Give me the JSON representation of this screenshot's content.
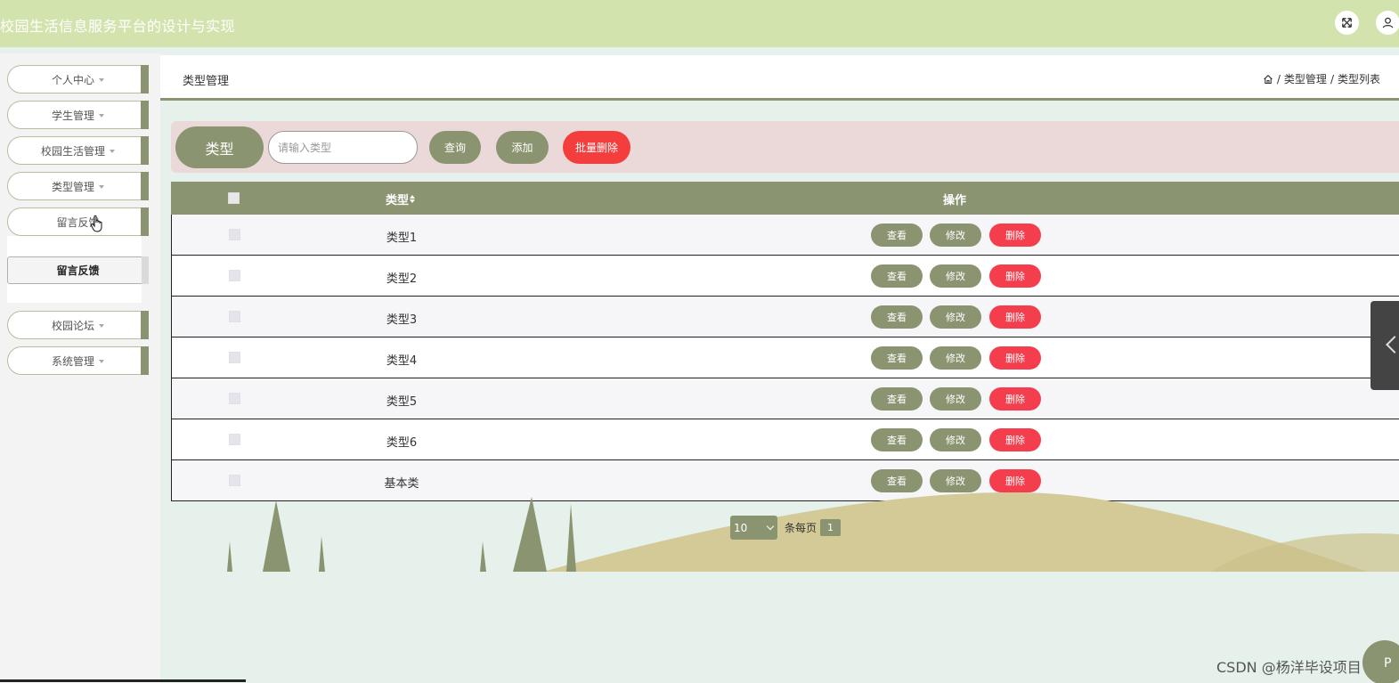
{
  "header": {
    "app_title": "校园生活信息服务平台的设计与实现"
  },
  "sidebar": {
    "items": [
      {
        "label": "个人中心"
      },
      {
        "label": "学生管理"
      },
      {
        "label": "校园生活管理"
      },
      {
        "label": "类型管理"
      },
      {
        "label": "留言反馈"
      },
      {
        "label": "校园论坛"
      },
      {
        "label": "系统管理"
      }
    ],
    "submenu_item": "留言反馈"
  },
  "page": {
    "title": "类型管理",
    "breadcrumb": [
      "类型管理",
      "类型列表"
    ]
  },
  "search": {
    "label": "类型",
    "placeholder": "请输入类型",
    "query_button": "查询",
    "add_button": "添加",
    "batch_delete_button": "批量删除"
  },
  "table": {
    "columns": [
      "类型",
      "操作"
    ],
    "rows": [
      {
        "type": "类型1"
      },
      {
        "type": "类型2"
      },
      {
        "type": "类型3"
      },
      {
        "type": "类型4"
      },
      {
        "type": "类型5"
      },
      {
        "type": "类型6"
      },
      {
        "type": "基本类"
      }
    ],
    "actions": {
      "view": "查看",
      "edit": "修改",
      "delete": "删除"
    }
  },
  "pagination": {
    "page_size": "10",
    "per_page_label": "条每页",
    "current_page": "1"
  },
  "watermark": "CSDN @杨洋毕设项目",
  "corner_badge": "P",
  "colors": {
    "header_bg": "#d3e3ad",
    "accent_olive": "#8b9470",
    "danger_red": "#f43e3d",
    "search_bar_bg": "#ead9d8",
    "page_bg": "#e6f1ec"
  }
}
